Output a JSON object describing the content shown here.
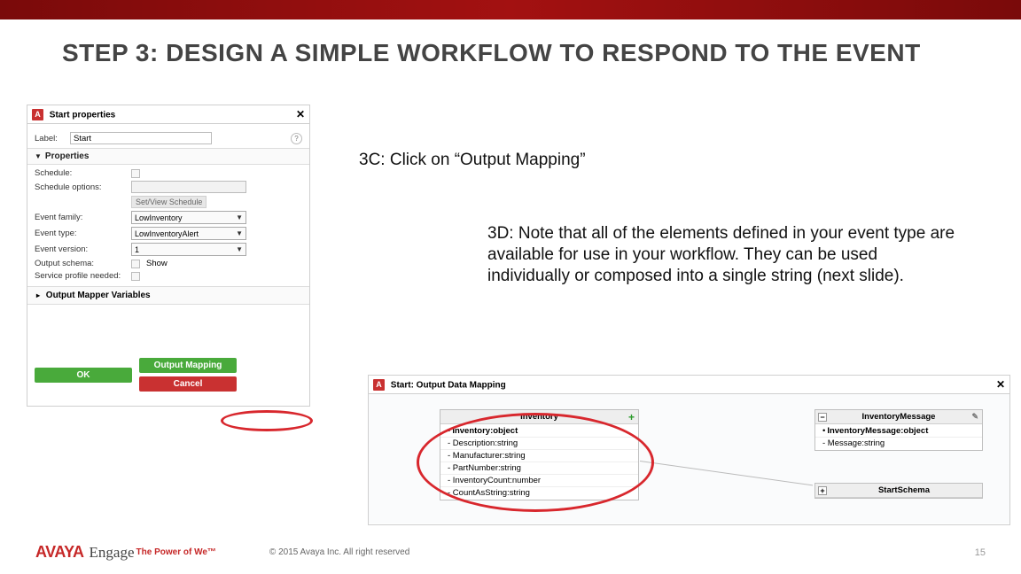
{
  "title": "STEP 3: DESIGN A SIMPLE WORKFLOW TO RESPOND TO THE EVENT",
  "note3c": "3C: Click on “Output Mapping”",
  "note3d": "3D: Note that all of the elements defined in your event type are available for use in your workflow. They can be used individually or composed into a single string (next slide).",
  "panel": {
    "title": "Start properties",
    "label_lbl": "Label:",
    "label_val": "Start",
    "props_section": "Properties",
    "schedule_lbl": "Schedule:",
    "schedopts_lbl": "Schedule options:",
    "setview_btn": "Set/View Schedule",
    "family_lbl": "Event family:",
    "family_val": "LowInventory",
    "type_lbl": "Event type:",
    "type_val": "LowInventoryAlert",
    "version_lbl": "Event version:",
    "version_val": "1",
    "outschema_lbl": "Output schema:",
    "outschema_show": "Show",
    "profile_lbl": "Service profile needed:",
    "outmap_section": "Output Mapper Variables",
    "ok": "OK",
    "output_mapping": "Output Mapping",
    "cancel": "Cancel"
  },
  "panel2": {
    "title": "Start: Output Data Mapping",
    "inv_title": "Inventory",
    "inv_root": "Inventory:object",
    "inv_items": [
      "- Description:string",
      "- Manufacturer:string",
      "- PartNumber:string",
      "- InventoryCount:number",
      "- CountAsString:string"
    ],
    "msg_title": "InventoryMessage",
    "msg_root": "InventoryMessage:object",
    "msg_item": "- Message:string",
    "start_schema": "StartSchema"
  },
  "footer": {
    "brand": "AVAYA",
    "engage": "Engage",
    "tagline": "The Power of We™",
    "copyright": "© 2015 Avaya Inc. All right reserved",
    "page": "15"
  }
}
